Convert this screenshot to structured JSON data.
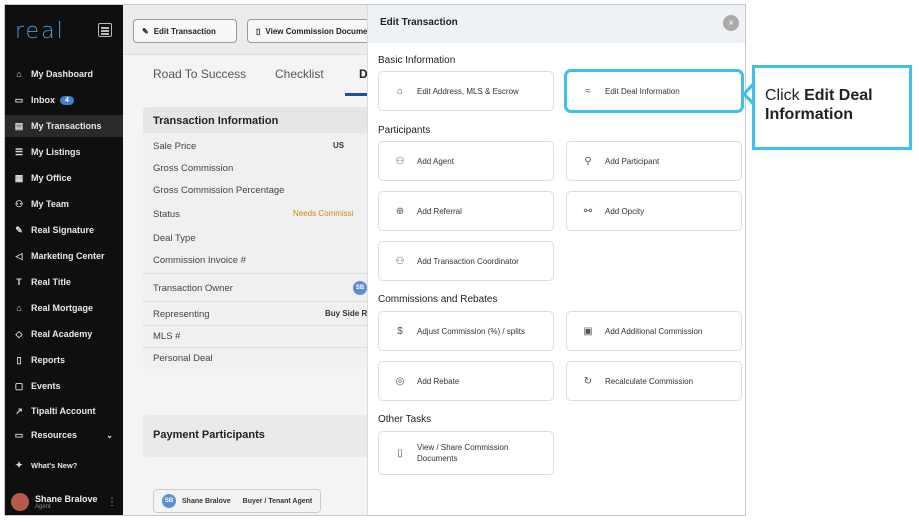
{
  "sidebar": {
    "logo": "real",
    "items": [
      {
        "label": "My Dashboard",
        "icon": "home-icon",
        "glyph": "⌂"
      },
      {
        "label": "Inbox",
        "icon": "inbox-icon",
        "glyph": "▭",
        "badge": "4"
      },
      {
        "label": "My Transactions",
        "icon": "transactions-icon",
        "glyph": "▤"
      },
      {
        "label": "My Listings",
        "icon": "listings-icon",
        "glyph": "☰"
      },
      {
        "label": "My Office",
        "icon": "office-icon",
        "glyph": "▦"
      },
      {
        "label": "My Team",
        "icon": "team-icon",
        "glyph": "⚇"
      },
      {
        "label": "Real Signature",
        "icon": "signature-icon",
        "glyph": "✎"
      },
      {
        "label": "Marketing Center",
        "icon": "megaphone-icon",
        "glyph": "◁"
      },
      {
        "label": "Real Title",
        "icon": "title-icon",
        "glyph": "T"
      },
      {
        "label": "Real Mortgage",
        "icon": "bank-icon",
        "glyph": "⌂"
      },
      {
        "label": "Real Academy",
        "icon": "academy-icon",
        "glyph": "◇"
      },
      {
        "label": "Reports",
        "icon": "reports-icon",
        "glyph": "▯"
      },
      {
        "label": "Events",
        "icon": "calendar-icon",
        "glyph": "▢"
      },
      {
        "label": "Tipalti Account",
        "icon": "external-link-icon",
        "glyph": "↗"
      },
      {
        "label": "Resources",
        "icon": "folder-icon",
        "glyph": "▭"
      },
      {
        "label": "What's New?",
        "icon": "sparkle-icon",
        "glyph": "✦"
      }
    ],
    "user": {
      "name": "Shane Bralove",
      "role": "Agent"
    }
  },
  "topbar": {
    "edit_transaction": "Edit Transaction",
    "view_commission": "View Commission Documents"
  },
  "tabs": [
    "Road To Success",
    "Checklist",
    "De"
  ],
  "transaction": {
    "title": "Transaction Information",
    "rows": [
      {
        "label": "Sale Price",
        "value": "US"
      },
      {
        "label": "Gross Commission",
        "value": ""
      },
      {
        "label": "Gross Commission Percentage",
        "value": ""
      },
      {
        "label": "Status",
        "value": "Needs Commissi"
      },
      {
        "label": "Deal Type",
        "value": ""
      },
      {
        "label": "Commission Invoice #",
        "value": ""
      },
      {
        "label": "Transaction Owner",
        "value": "SB"
      },
      {
        "label": "Representing",
        "value": "Buy Side Re"
      },
      {
        "label": "MLS #",
        "value": ""
      },
      {
        "label": "Personal Deal",
        "value": ""
      }
    ]
  },
  "payment": {
    "title": "Payment Participants",
    "chip_initials": "SB",
    "chip_name": "Shane Bralove",
    "chip_role": "Buyer / Tenant Agent"
  },
  "panel": {
    "title": "Edit Transaction",
    "close_glyph": "×",
    "sections": {
      "basic": "Basic Information",
      "participants": "Participants",
      "commissions": "Commissions and Rebates",
      "other": "Other Tasks"
    },
    "buttons": {
      "edit_address": "Edit Address, MLS & Escrow",
      "edit_deal": "Edit Deal Information",
      "add_agent": "Add Agent",
      "add_participant": "Add Participant",
      "add_referral": "Add Referral",
      "add_opcity": "Add Opcity",
      "add_tc": "Add Transaction Coordinator",
      "adjust_commission": "Adjust Commission (%) / splits",
      "add_additional_commission": "Add Additional Commission",
      "add_rebate": "Add Rebate",
      "recalculate": "Recalculate Commission",
      "view_share_1": "View / Share Commission",
      "view_share_2": "Documents"
    }
  },
  "callout": {
    "prefix": "Click ",
    "bold": "Edit Deal Information"
  },
  "colors": {
    "accent": "#3fc0e8",
    "sidebar_bg": "#0f0f0f",
    "logo": "#4d9bd6"
  }
}
